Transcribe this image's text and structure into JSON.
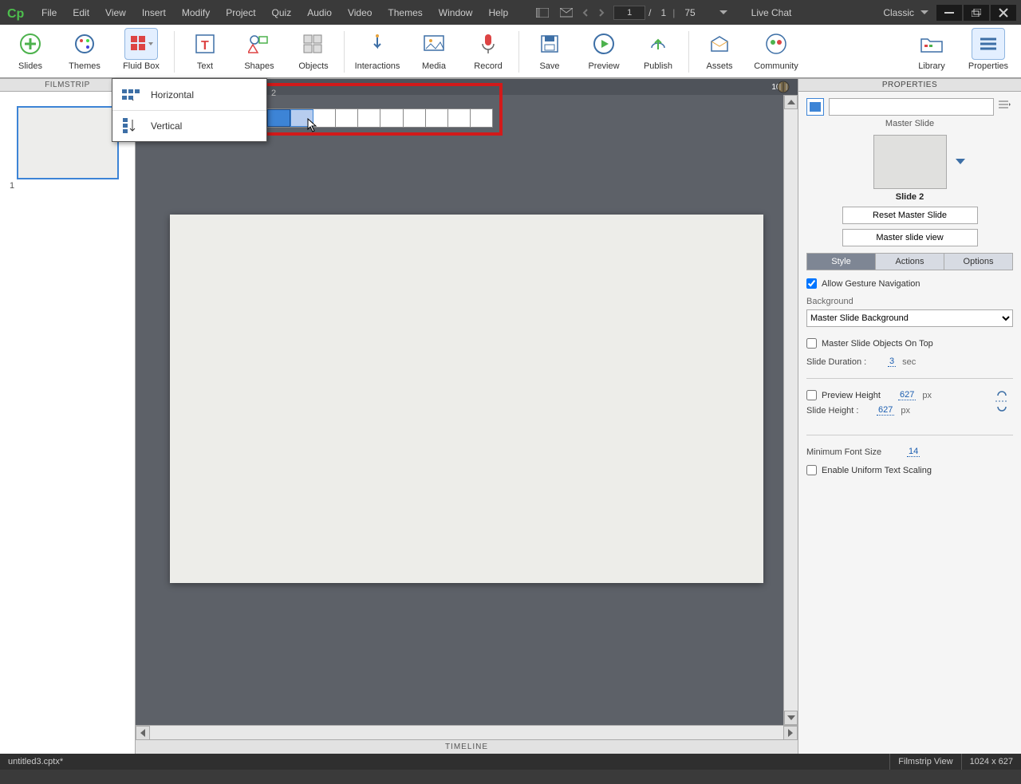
{
  "menubar": {
    "items": [
      "File",
      "Edit",
      "View",
      "Insert",
      "Modify",
      "Project",
      "Quiz",
      "Audio",
      "Video",
      "Themes",
      "Window",
      "Help"
    ]
  },
  "topbar": {
    "page_current": "1",
    "page_sep": "/",
    "page_total": "1",
    "zoom": "75",
    "live_chat": "Live Chat",
    "workspace": "Classic"
  },
  "ribbon": {
    "slides": "Slides",
    "themes": "Themes",
    "fluid_box": "Fluid Box",
    "text": "Text",
    "shapes": "Shapes",
    "objects": "Objects",
    "interactions": "Interactions",
    "media": "Media",
    "record": "Record",
    "save": "Save",
    "preview": "Preview",
    "publish": "Publish",
    "assets": "Assets",
    "community": "Community",
    "library": "Library",
    "properties": "Properties"
  },
  "filmstrip": {
    "header": "FILMSTRIP",
    "thumb_num": "1"
  },
  "dropdown": {
    "horizontal": "Horizontal",
    "vertical": "Vertical"
  },
  "col_picker": {
    "count_label": "2"
  },
  "ruler": {
    "right_label": "102"
  },
  "timeline": {
    "label": "TIMELINE"
  },
  "properties": {
    "header": "PROPERTIES",
    "master_slide_label": "Master Slide",
    "slide_name": "Slide 2",
    "reset_master": "Reset Master Slide",
    "master_view": "Master slide view",
    "tabs": {
      "style": "Style",
      "actions": "Actions",
      "options": "Options"
    },
    "allow_gesture": "Allow Gesture Navigation",
    "background_label": "Background",
    "background_value": "Master Slide Background",
    "master_on_top": "Master Slide Objects On Top",
    "slide_duration_label": "Slide Duration :",
    "slide_duration_value": "3",
    "slide_duration_unit": "sec",
    "preview_height_label": "Preview Height",
    "slide_height_label": "Slide Height :",
    "height_value": "627",
    "height_unit": "px",
    "min_font_label": "Minimum Font Size",
    "min_font_value": "14",
    "uniform_scaling": "Enable Uniform Text Scaling"
  },
  "statusbar": {
    "file": "untitled3.cptx*",
    "view": "Filmstrip View",
    "dimensions": "1024 x 627"
  }
}
